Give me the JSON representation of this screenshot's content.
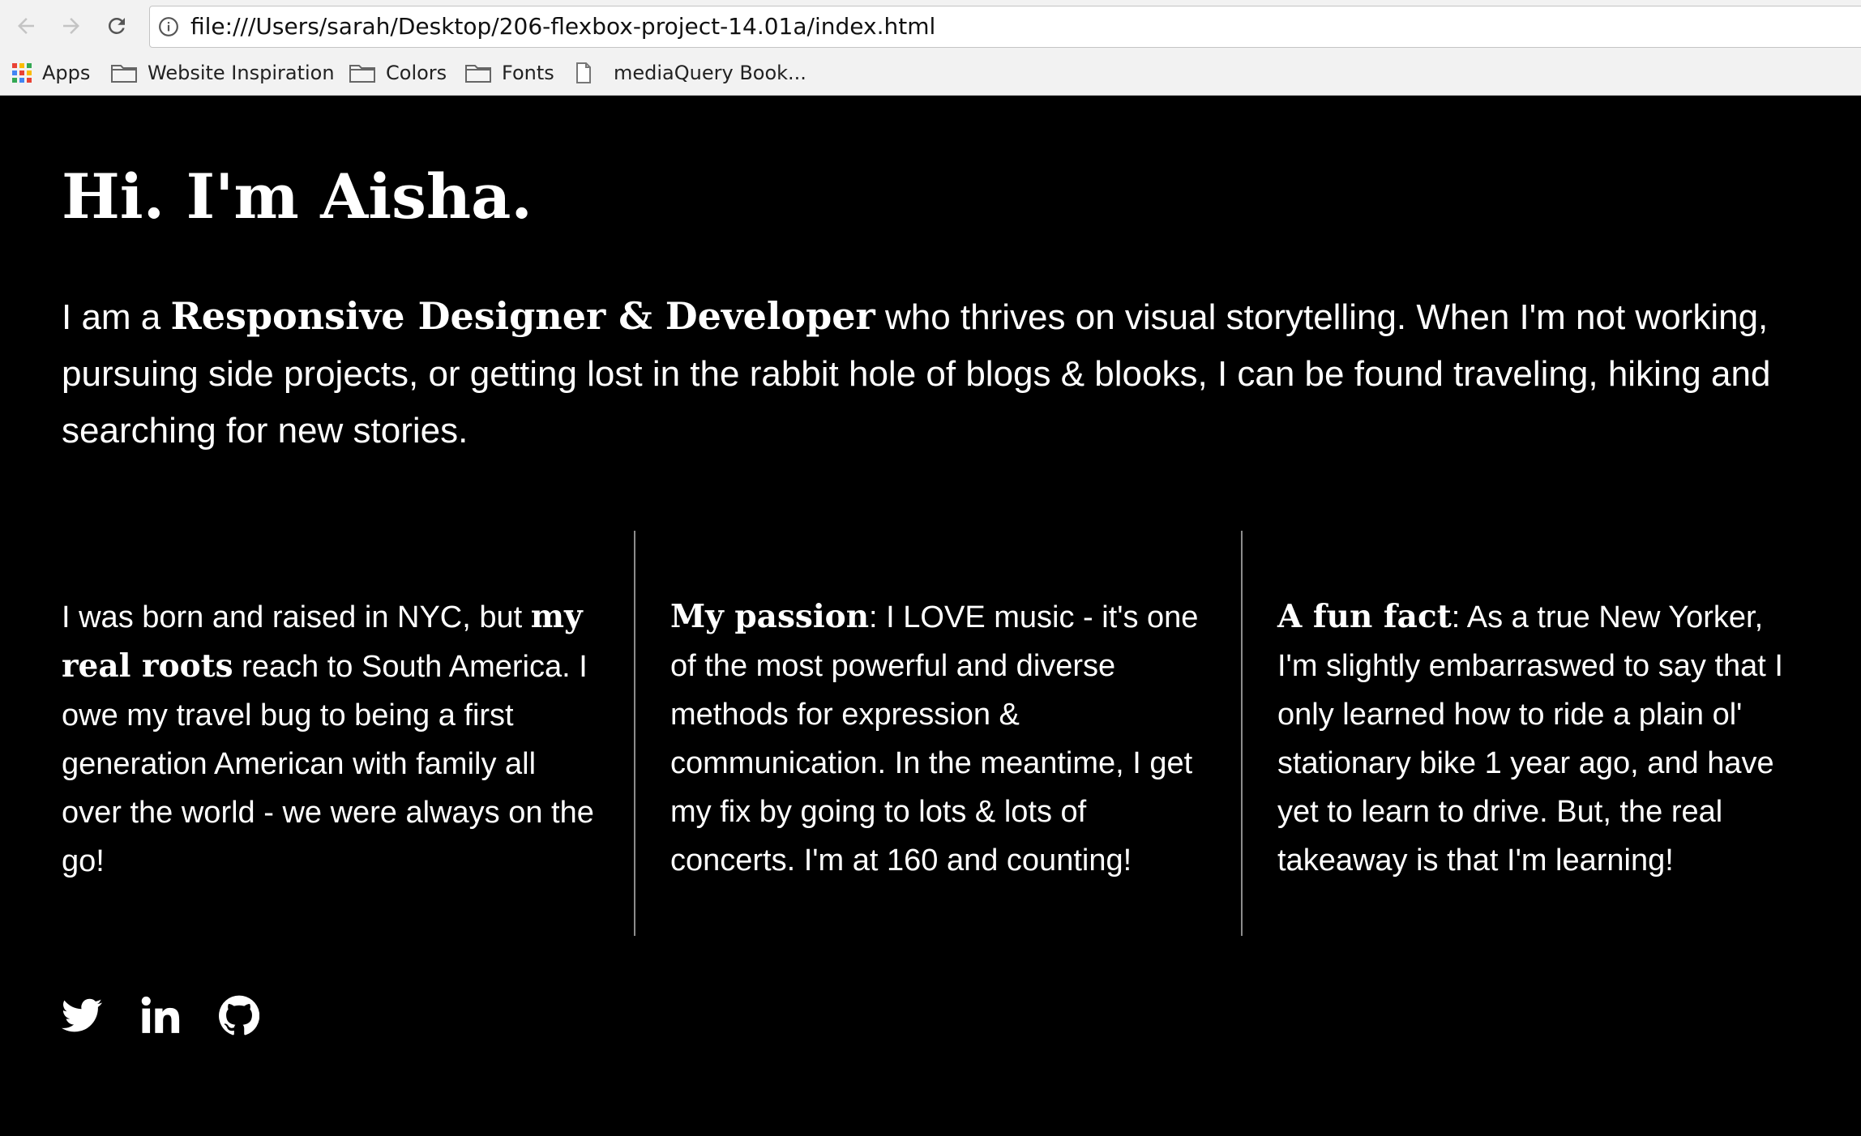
{
  "browser": {
    "url": "file:///Users/sarah/Desktop/206-flexbox-project-14.01a/index.html",
    "bookmarks": [
      {
        "label": "Apps",
        "icon": "apps-grid-icon"
      },
      {
        "label": "Website Inspiration",
        "icon": "folder-icon"
      },
      {
        "label": "Colors",
        "icon": "folder-icon"
      },
      {
        "label": "Fonts",
        "icon": "folder-icon"
      },
      {
        "label": "mediaQuery Book...",
        "icon": "page-icon"
      }
    ]
  },
  "page": {
    "title": "Hi. I'm Aisha.",
    "intro": {
      "before": "I am a ",
      "strong": "Responsive Designer & Developer",
      "after": " who thrives on visual storytelling. When I'm not working, pursuing side projects, or getting lost in the rabbit hole of blogs & blooks, I can be found traveling, hiking and searching for new stories."
    },
    "columns": [
      {
        "before": "I was born and raised in NYC, but ",
        "strong": "my real roots",
        "after": " reach to South America. I owe my travel bug to being a first generation American with family all over the world - we were always on the go!"
      },
      {
        "before": "",
        "strong": "My passion",
        "after": ": I LOVE music - it's one of the most powerful and diverse methods for expression & communication. In the meantime, I get my fix by going to lots & lots of concerts. I'm at 160 and counting!"
      },
      {
        "before": "",
        "strong": "A fun fact",
        "after": ": As a true New Yorker, I'm slightly embarraswed to say that I only learned how to ride a plain ol' stationary bike 1 year ago, and have yet to learn to drive. But, the real takeaway is that I'm learning!"
      }
    ],
    "social": [
      "twitter-icon",
      "linkedin-icon",
      "github-icon"
    ]
  },
  "colors": {
    "page_background": "#000000",
    "text": "#ffffff",
    "divider": "#8c8c8c",
    "chrome_background": "#f2f2f2"
  }
}
